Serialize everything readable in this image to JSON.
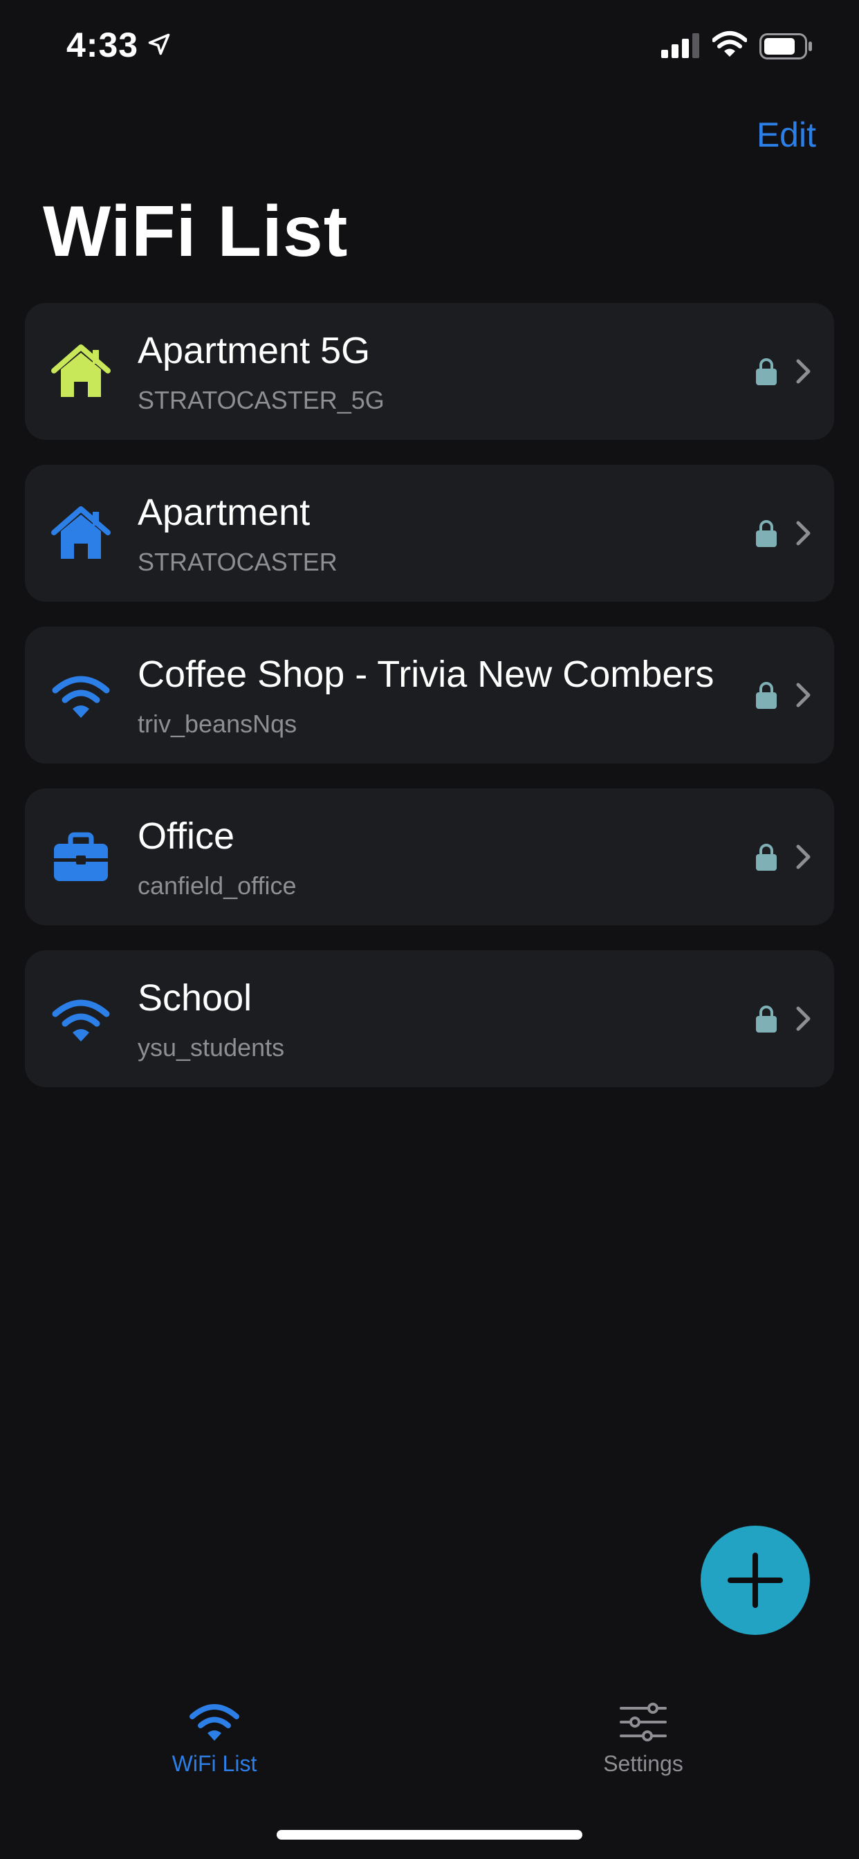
{
  "status_bar": {
    "time": "4:33",
    "icons": [
      "location-arrow-icon",
      "cellular-signal-icon",
      "wifi-icon",
      "battery-icon"
    ]
  },
  "header": {
    "edit_label": "Edit",
    "title": "WiFi List"
  },
  "networks": [
    {
      "name": "Apartment 5G",
      "ssid": "STRATOCASTER_5G",
      "icon": "home-icon",
      "icon_color": "#c8e85a",
      "locked": true
    },
    {
      "name": "Apartment",
      "ssid": "STRATOCASTER",
      "icon": "home-icon",
      "icon_color": "#2d7fe8",
      "locked": true
    },
    {
      "name": "Coffee Shop - Trivia New Combers",
      "ssid": "triv_beansNqs",
      "icon": "wifi-icon",
      "icon_color": "#2d7fe8",
      "locked": true
    },
    {
      "name": "Office",
      "ssid": "canfield_office",
      "icon": "briefcase-icon",
      "icon_color": "#2d7fe8",
      "locked": true
    },
    {
      "name": "School",
      "ssid": "ysu_students",
      "icon": "wifi-icon",
      "icon_color": "#2d7fe8",
      "locked": true
    }
  ],
  "add_button": {
    "icon": "plus-icon",
    "color": "#23a3c4"
  },
  "tab_bar": {
    "tabs": [
      {
        "label": "WiFi List",
        "icon": "wifi-icon",
        "active": true
      },
      {
        "label": "Settings",
        "icon": "sliders-icon",
        "active": false
      }
    ]
  },
  "colors": {
    "accent": "#2d7fe8",
    "background": "#111113",
    "card": "#1b1d20",
    "lock": "#7fb0b5",
    "secondary_text": "#8e8e93"
  }
}
